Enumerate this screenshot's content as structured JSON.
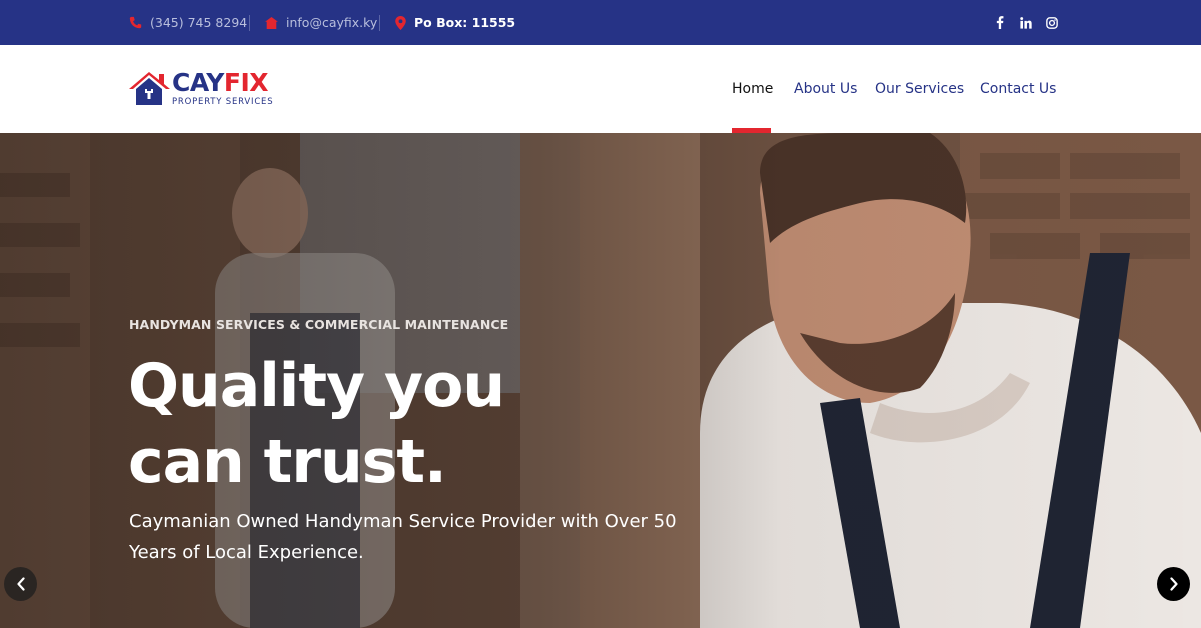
{
  "topbar": {
    "phone": "(345) 745 8294",
    "email": "info@cayfix.ky",
    "pobox": "Po Box: 11555",
    "social": [
      "f",
      "in",
      "instagram"
    ]
  },
  "logo": {
    "word_part1": "CAY",
    "word_part2": "FIX",
    "subtitle": "PROPERTY SERVICES"
  },
  "nav": {
    "items": [
      {
        "label": "Home",
        "active": true
      },
      {
        "label": "About Us",
        "active": false
      },
      {
        "label": "Our Services",
        "active": false
      },
      {
        "label": "Contact Us",
        "active": false
      }
    ]
  },
  "hero": {
    "kicker": "HANDYMAN SERVICES & COMMERCIAL MAINTENANCE",
    "headline_line1": "Quality you",
    "headline_line2_plain": "can ",
    "headline_line2_bold": "trust.",
    "subtext": "Caymanian Owned Handyman Service Provider with Over 50 Years of Local Experience."
  },
  "icons": {
    "phone": "phone-icon",
    "email": "home-icon",
    "location": "map-pin-icon",
    "facebook": "facebook-icon",
    "linkedin": "linkedin-icon",
    "instagram": "instagram-icon",
    "prev": "chevron-left-icon",
    "next": "chevron-right-icon"
  },
  "colors": {
    "brand_blue": "#263386",
    "brand_red": "#e3262f"
  }
}
